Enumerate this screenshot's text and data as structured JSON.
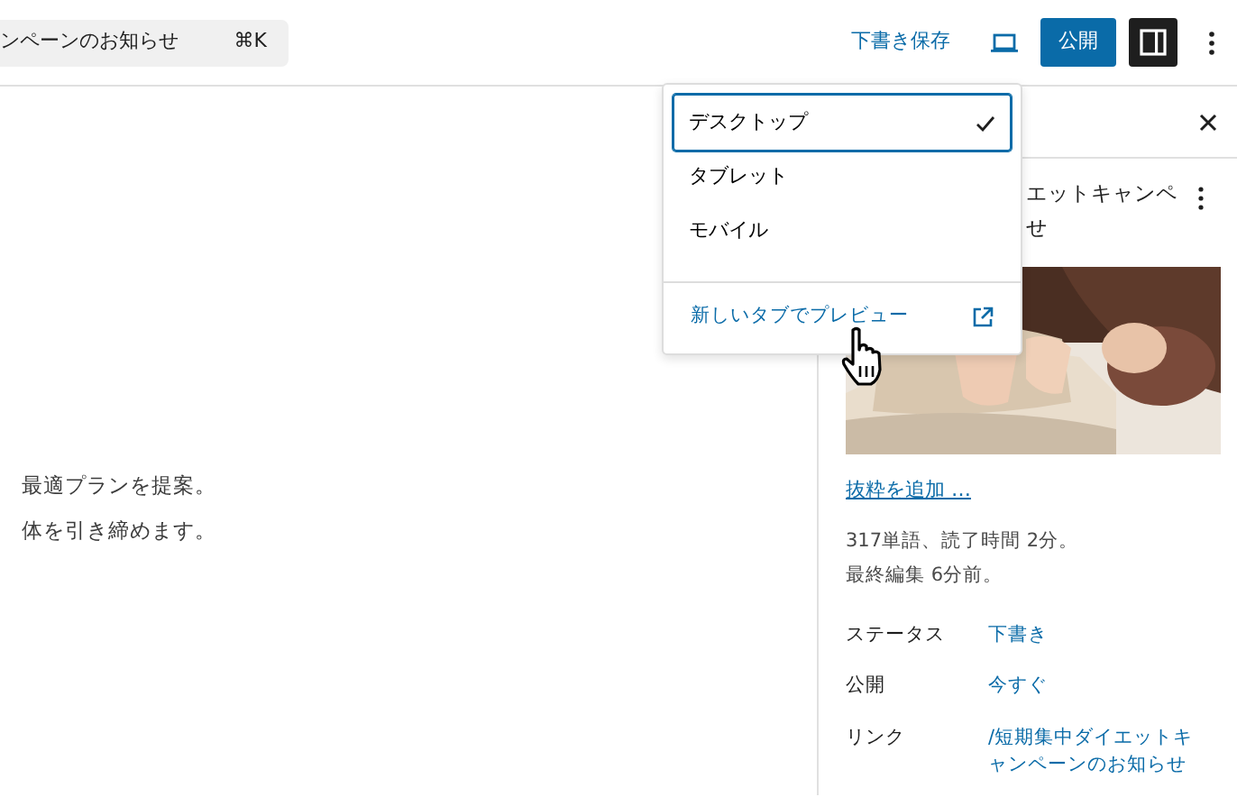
{
  "search": {
    "text": "ンペーンのお知らせ",
    "shortcut": "⌘K"
  },
  "toolbar": {
    "save_draft": "下書き保存",
    "publish": "公開",
    "sidebar_open": true
  },
  "content": {
    "lines": [
      "最適プランを提案。",
      "体を引き締めます。"
    ]
  },
  "sidebar": {
    "title_lines": [
      "エットキャンペ",
      "せ"
    ],
    "image": {
      "kind": "picture"
    },
    "excerpt_link": "抜粋を追加 …",
    "stats": [
      "317単語、読了時間 2分。",
      "最終編集 6分前。"
    ],
    "fields": [
      {
        "label": "ステータス",
        "value": "下書き"
      },
      {
        "label": "公開",
        "value": "今すぐ"
      },
      {
        "label": "リンク",
        "value": "/短期集中ダイエットキャンペーンのお知らせ"
      }
    ]
  },
  "preview_menu": {
    "items": [
      {
        "label": "デスクトップ",
        "selected": true
      },
      {
        "label": "タブレット",
        "selected": false
      },
      {
        "label": "モバイル",
        "selected": false
      }
    ],
    "open_in_new_tab": "新しいタブでプレビュー"
  }
}
